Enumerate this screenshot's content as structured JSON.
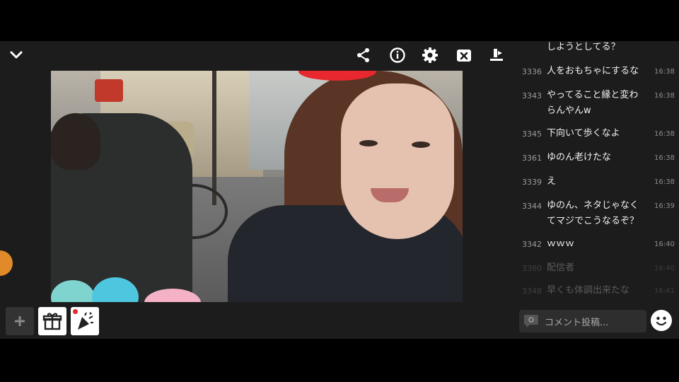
{
  "topbar": {
    "icons": [
      "chevron-down-icon",
      "share-icon",
      "info-icon",
      "gear-icon",
      "close-box-icon",
      "rotate-screen-icon"
    ]
  },
  "chat": {
    "messages": [
      {
        "num": "",
        "text": "しようとしてる？",
        "time": ""
      },
      {
        "num": "3336",
        "text": "人をおもちゃにするな",
        "time": "16:38"
      },
      {
        "num": "3343",
        "text": "やってること縁と変わらんやんw",
        "time": "16:38"
      },
      {
        "num": "3345",
        "text": "下向いて歩くなよ",
        "time": "16:38"
      },
      {
        "num": "3361",
        "text": "ゆのん老けたな",
        "time": "16:38"
      },
      {
        "num": "3339",
        "text": "え",
        "time": "16:38"
      },
      {
        "num": "3344",
        "text": "ゆのん、ネタじゃなくてマジでこうなるぞ？",
        "time": "16:39"
      },
      {
        "num": "3342",
        "text": "ｗｗｗ",
        "time": "16:40"
      },
      {
        "num": "3360",
        "text": "配信者",
        "time": "16:40"
      },
      {
        "num": "3348",
        "text": "早くも体調出来たな",
        "time": "16:41"
      }
    ]
  },
  "comment_input": {
    "placeholder": "コメント投稿..."
  },
  "bottom_buttons": {
    "icons": [
      "plus-icon",
      "gift-icon",
      "party-popper-icon"
    ]
  },
  "colors": {
    "background": "#1c1c1c",
    "accent_red": "#e8282e"
  }
}
